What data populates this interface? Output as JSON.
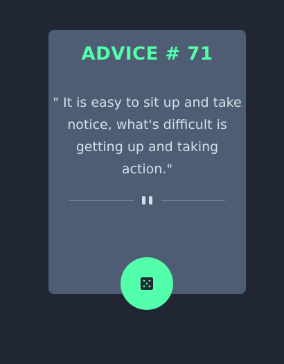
{
  "advice": {
    "title": "ADVICE # 71",
    "quote": "\" It is easy to sit up and take notice, what's difficult is getting up and taking action.\""
  },
  "icons": {
    "divider": "pause-icon",
    "button": "dice-icon"
  },
  "colors": {
    "background": "#202632",
    "card": "#4f5d74",
    "accent": "#53ffaa",
    "text": "#cee3e9"
  }
}
